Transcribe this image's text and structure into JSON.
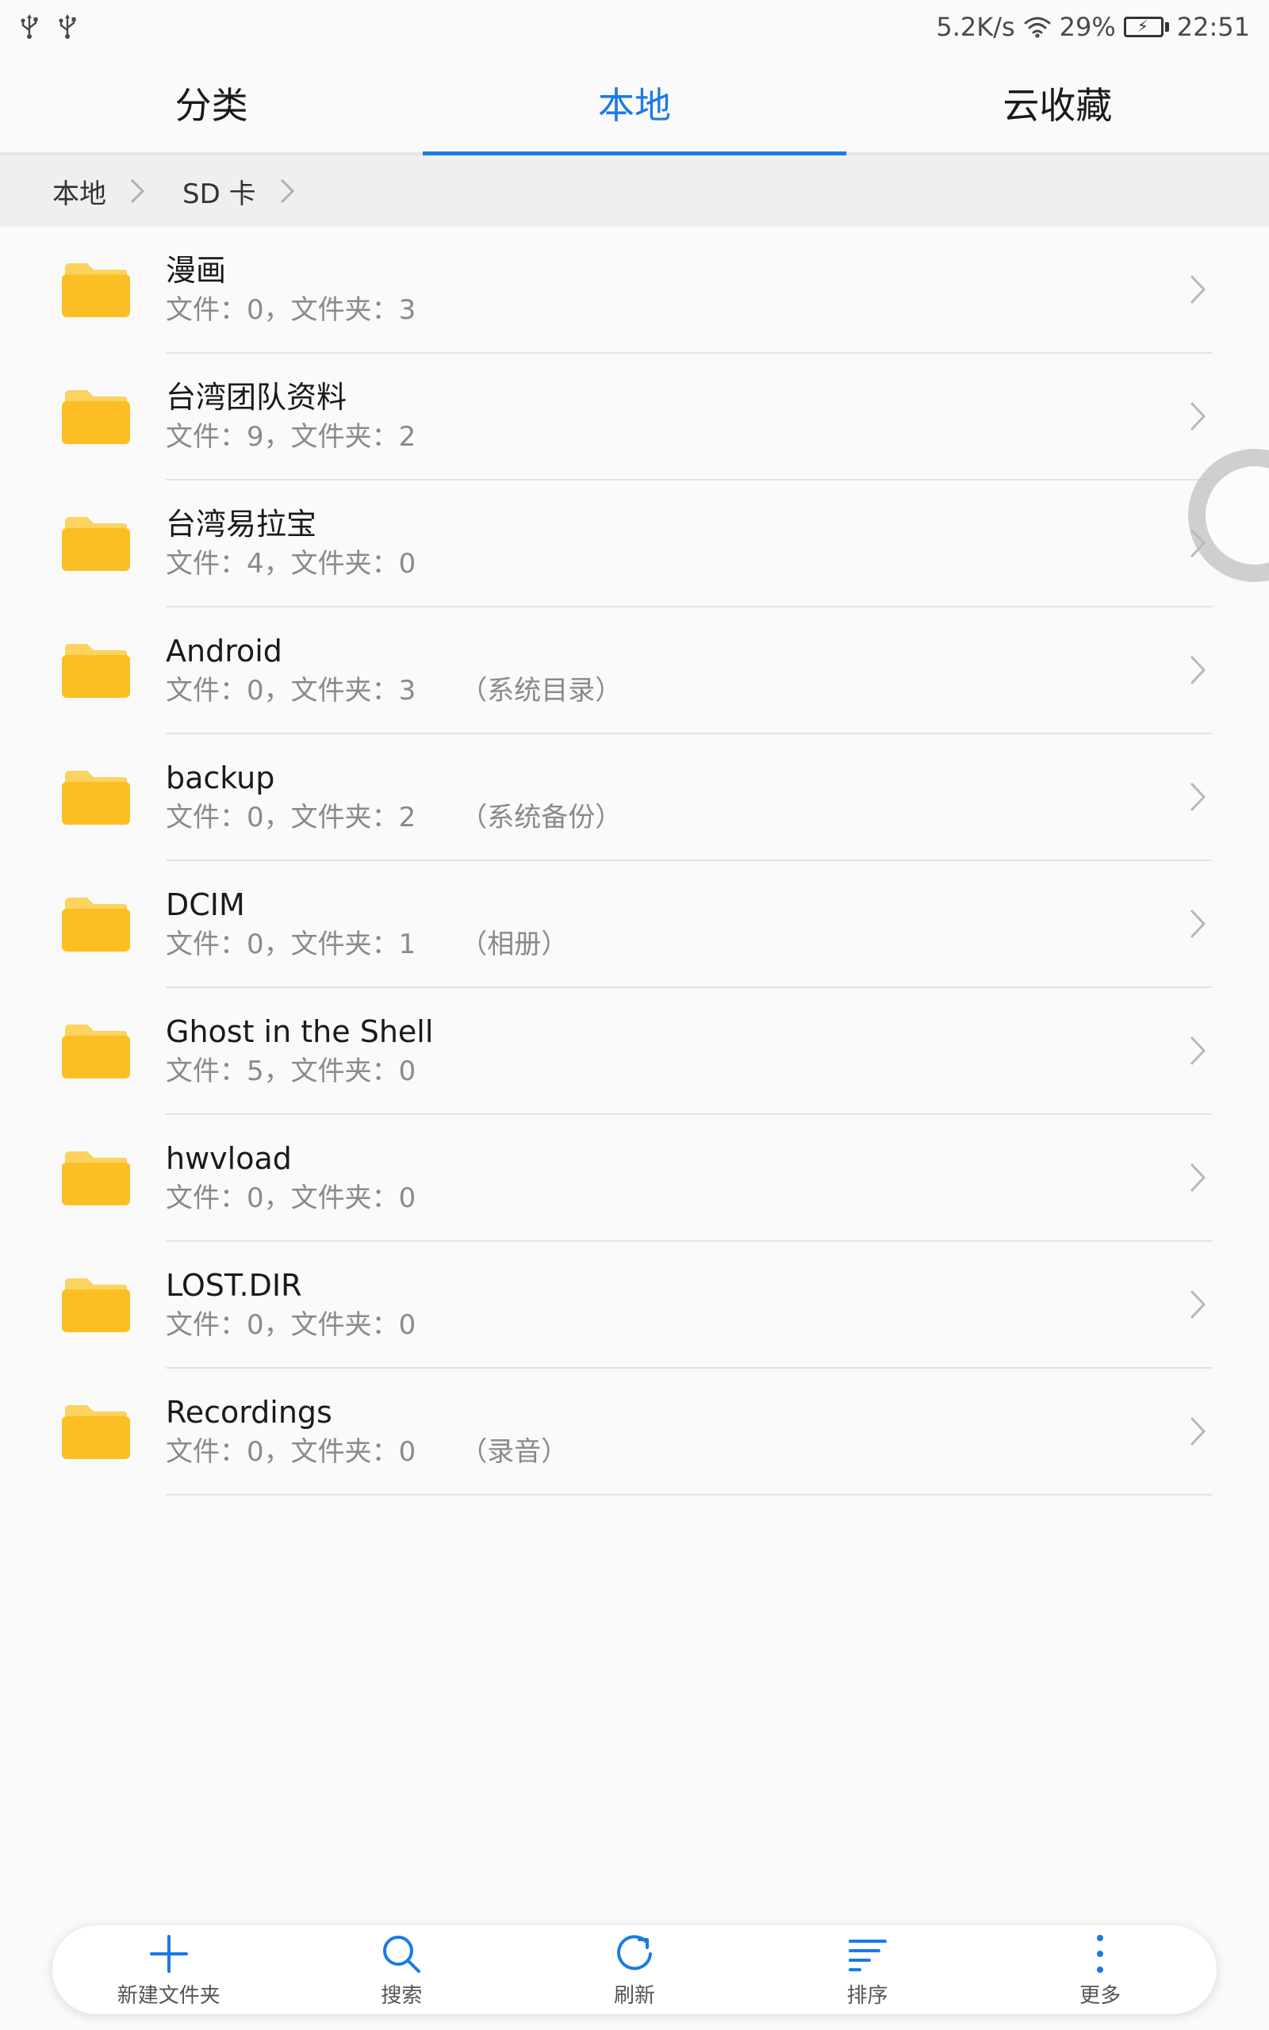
{
  "status_bar": {
    "left_icons": [
      "usb-icon",
      "usb-icon"
    ],
    "network_speed": "5.2K/s",
    "wifi_icon": "wifi-icon",
    "battery_percent": "29%",
    "battery_level": 0.29,
    "time": "22:51"
  },
  "tabs": [
    {
      "label": "分类",
      "active": false
    },
    {
      "label": "本地",
      "active": true
    },
    {
      "label": "云收藏",
      "active": false
    }
  ],
  "breadcrumb": [
    {
      "label": "本地"
    },
    {
      "label": "SD 卡"
    }
  ],
  "files": [
    {
      "name": "漫画",
      "meta": "文件：0，文件夹：3",
      "tag": ""
    },
    {
      "name": "台湾团队资料",
      "meta": "文件：9，文件夹：2",
      "tag": ""
    },
    {
      "name": "台湾易拉宝",
      "meta": "文件：4，文件夹：0",
      "tag": ""
    },
    {
      "name": "Android",
      "meta": "文件：0，文件夹：3",
      "tag": "（系统目录）"
    },
    {
      "name": "backup",
      "meta": "文件：0，文件夹：2",
      "tag": "（系统备份）"
    },
    {
      "name": "DCIM",
      "meta": "文件：0，文件夹：1",
      "tag": "（相册）"
    },
    {
      "name": "Ghost in the Shell",
      "meta": "文件：5，文件夹：0",
      "tag": ""
    },
    {
      "name": "hwvload",
      "meta": "文件：0，文件夹：0",
      "tag": ""
    },
    {
      "name": "LOST.DIR",
      "meta": "文件：0，文件夹：0",
      "tag": ""
    },
    {
      "name": "Recordings",
      "meta": "文件：0，文件夹：0",
      "tag": "（录音）"
    }
  ],
  "toolbar": {
    "new_folder": "新建文件夹",
    "search": "搜索",
    "refresh": "刷新",
    "sort": "排序",
    "more": "更多"
  },
  "colors": {
    "accent": "#1a7ae8",
    "folder": "#fbbf24",
    "folder_tab": "#fcd35e",
    "battery": "#2fb24a"
  }
}
